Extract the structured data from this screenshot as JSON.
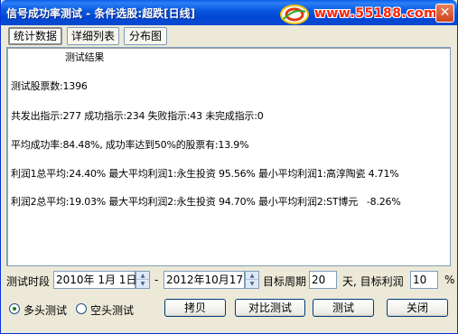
{
  "window": {
    "title": "信号成功率测试 - 条件选股:超跌[日线]",
    "close_glyph": "✕"
  },
  "watermark": {
    "url": "www.55188.com"
  },
  "tabs": [
    {
      "label": "统计数据",
      "active": true
    },
    {
      "label": "详细列表",
      "active": false
    },
    {
      "label": "分布图",
      "active": false
    }
  ],
  "results": {
    "heading": "测试结果",
    "stock_count": "测试股票数:1396",
    "signals": "共发出指示:277 成功指示:234 失败指示:43 未完成指示:0",
    "success_rate": "平均成功率:84.48%, 成功率达到50%的股票有:13.9%",
    "profit1": "利润1总平均:24.40% 最大平均利润1:永生投资 95.56% 最小平均利润1:高淳陶瓷 4.71%",
    "profit2": "利润2总平均:19.03% 最大平均利润2:永生投资 94.70% 最小平均利润2:ST博元   -8.26%"
  },
  "controls": {
    "period_label": "测试时段",
    "start_date": "2010年 1月 1日",
    "dash": "-",
    "end_date": "2012年10月17日",
    "target_period_label": "目标周期",
    "target_period_value": "20",
    "target_profit_label": "天, 目标利润",
    "target_profit_value": "10",
    "percent": "%",
    "spin_up": "▲",
    "spin_down": "▼"
  },
  "modes": [
    {
      "label": "多头测试",
      "selected": true
    },
    {
      "label": "空头测试",
      "selected": false
    }
  ],
  "buttons": {
    "copy": "拷贝",
    "compare": "对比测试",
    "test": "测试",
    "close": "关闭"
  }
}
